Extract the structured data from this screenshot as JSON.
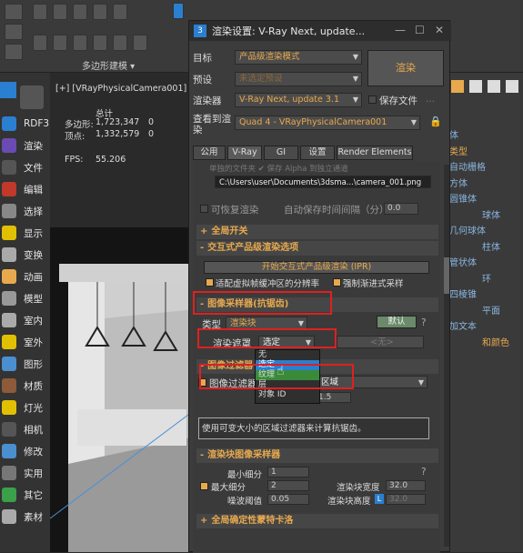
{
  "toolbar": {
    "modeling_label": "多边形建模 ▾"
  },
  "left_panel": {
    "items": [
      {
        "label": "RDF3",
        "color": "#2a7fd0",
        "icon": "rdf3-icon"
      },
      {
        "label": "渲染",
        "color": "#6a4bb3",
        "icon": "teapot-render-icon"
      },
      {
        "label": "文件",
        "color": "#555",
        "icon": "file-icon"
      },
      {
        "label": "编辑",
        "color": "#c0392b",
        "icon": "edit-icon"
      },
      {
        "label": "选择",
        "color": "#888",
        "icon": "select-icon"
      },
      {
        "label": "显示",
        "color": "#e0c000",
        "icon": "display-icon"
      },
      {
        "label": "变换",
        "color": "#aaa",
        "icon": "transform-icon"
      },
      {
        "label": "动画",
        "color": "#e8a94e",
        "icon": "animation-icon"
      },
      {
        "label": "模型",
        "color": "#999",
        "icon": "model-icon"
      },
      {
        "label": "室内",
        "color": "#aaa",
        "icon": "indoor-icon"
      },
      {
        "label": "室外",
        "color": "#e0c000",
        "icon": "outdoor-icon"
      },
      {
        "label": "图形",
        "color": "#4a8fd0",
        "icon": "shape-icon"
      },
      {
        "label": "材质",
        "color": "#8d5a3a",
        "icon": "material-icon"
      },
      {
        "label": "灯光",
        "color": "#e0c000",
        "icon": "light-icon"
      },
      {
        "label": "相机",
        "color": "#555",
        "icon": "camera-icon"
      },
      {
        "label": "修改",
        "color": "#4a8fd0",
        "icon": "modify-icon"
      },
      {
        "label": "实用",
        "color": "#777",
        "icon": "utility-icon"
      },
      {
        "label": "其它",
        "color": "#3aa04a",
        "icon": "other-icon"
      },
      {
        "label": "素材",
        "color": "#aaa",
        "icon": "asset-icon"
      }
    ]
  },
  "viewport": {
    "label": "[+] [VRayPhysicalCamera001] [I",
    "stats_header": "总计",
    "poly_label": "多边形:",
    "poly_value": "1,723,347",
    "poly_zero": "0",
    "vert_label": "顶点:",
    "vert_value": "1,332,579",
    "vert_zero": "0",
    "fps_label": "FPS:",
    "fps_value": "55.206"
  },
  "right_panel": {
    "items": [
      "体",
      "类型",
      "自动栅格",
      "方体",
      "圆锥体",
      "球体",
      "几何球体",
      "柱体",
      "管状体",
      "环",
      "四棱锥",
      "平面",
      "加文本",
      "和颜色"
    ]
  },
  "dialog": {
    "title": "渲染设置: V-Ray Next, update...",
    "target_label": "目标",
    "target_value": "产品级渲染模式",
    "preset_label": "预设",
    "preset_value": "未选定预设",
    "renderer_label": "渲染器",
    "renderer_value": "V-Ray Next, update 3.1",
    "save_file_label": "保存文件",
    "render_button": "渲染",
    "view_label": "查看到渲染",
    "view_value": "Quad 4 - VRayPhysicalCamera001",
    "tabs": [
      "公用",
      "V-Ray",
      "GI",
      "设置",
      "Render Elements"
    ],
    "top_partial": "单独的文件夹       ✔ 保存 Alpha 到独立通道",
    "path_value": "C:\\Users\\user\\Documents\\3dsma...\\camera_001.png",
    "resumable_label": "可恢复渲染",
    "autosave_label": "自动保存时间间隔（分）",
    "autosave_value": "0.0",
    "sec_global": "全局开关",
    "sec_ipr": "交互式产品级渲染选项",
    "ipr_button": "开始交互式产品级渲染 (IPR)",
    "ipr_fit_label": "适配虚拟帧缓冲区的分辨率",
    "ipr_progressive_label": "强制渐进式采样",
    "sec_sampler": "图像采样器(抗锯齿)",
    "type_label": "类型",
    "type_value": "渲染块",
    "default_button": "默认",
    "mask_label": "渲染遮罩",
    "mask_value": "选定",
    "mask_none": "<无>",
    "mask_options": [
      "无",
      "选定",
      "纹理",
      "层",
      "对象 ID"
    ],
    "sec_filter": "图像过滤器",
    "filter_label": "图像过滤器",
    "filter_value": "区域",
    "filter_size_value": "1.5",
    "filter_desc": "使用可变大小的区域过滤器来计算抗锯齿。",
    "sec_bucket": "渲染块图像采样器",
    "min_sub_label": "最小细分",
    "min_sub_value": "1",
    "max_sub_label": "最大细分",
    "max_sub_value": "2",
    "bucket_w_label": "渲染块宽度",
    "bucket_w_value": "32.0",
    "noise_label": "噪波阈值",
    "noise_value": "0.05",
    "bucket_h_label": "渲染块高度",
    "bucket_h_value": "32.0",
    "bucket_lock": "L",
    "sec_global_dmc": "全局确定性蒙特卡洛"
  }
}
